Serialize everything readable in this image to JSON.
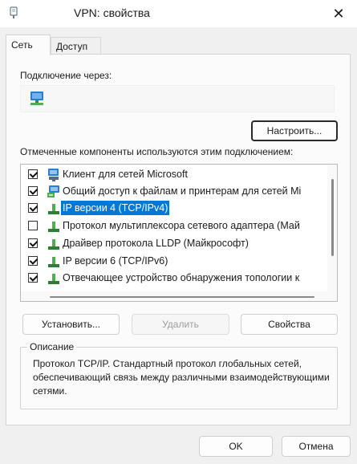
{
  "window": {
    "title": "VPN: свойства",
    "close_glyph": "✕"
  },
  "tabs": [
    {
      "label": "Сеть",
      "active": true
    },
    {
      "label": "Доступ",
      "active": false
    }
  ],
  "connection": {
    "label": "Подключение через:",
    "adapter_icon": "network-adapter-icon"
  },
  "buttons": {
    "configure": "Настроить...",
    "install": "Установить...",
    "remove": "Удалить",
    "properties": "Свойства",
    "ok": "OK",
    "cancel": "Отмена"
  },
  "components": {
    "label": "Отмеченные компоненты используются этим подключением:",
    "items": [
      {
        "label": "Клиент для сетей Microsoft",
        "checked": true,
        "icon": "network-client-icon",
        "selected": false
      },
      {
        "label": "Общий доступ к файлам и принтерам для сетей Mi",
        "checked": true,
        "icon": "network-service-icon",
        "selected": false
      },
      {
        "label": "IP версии 4 (TCP/IPv4)",
        "checked": true,
        "icon": "protocol-icon",
        "selected": true
      },
      {
        "label": "Протокол мультиплексора сетевого адаптера (Май",
        "checked": false,
        "icon": "protocol-icon",
        "selected": false
      },
      {
        "label": "Драйвер протокола LLDP (Майкрософт)",
        "checked": true,
        "icon": "protocol-icon",
        "selected": false
      },
      {
        "label": "IP версии 6 (TCP/IPv6)",
        "checked": true,
        "icon": "protocol-icon",
        "selected": false
      },
      {
        "label": "Отвечающее устройство обнаружения топологии к",
        "checked": true,
        "icon": "protocol-icon",
        "selected": false
      }
    ]
  },
  "description": {
    "title": "Описание",
    "text": "Протокол TCP/IP. Стандартный протокол глобальных сетей, обеспечивающий связь между различными взаимодействующими сетями."
  }
}
